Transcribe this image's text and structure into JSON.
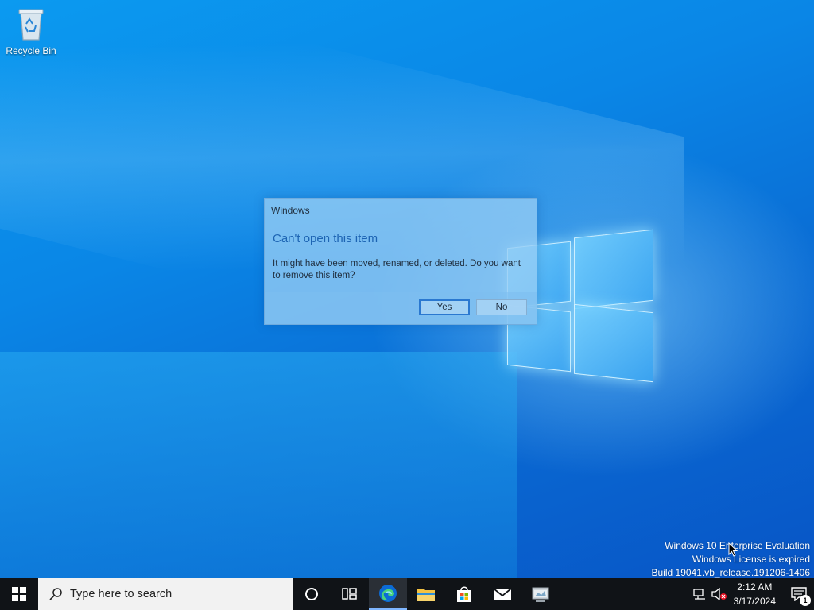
{
  "desktop": {
    "icons": [
      {
        "label": "Recycle Bin",
        "icon": "recycle-bin-icon"
      }
    ]
  },
  "dialog": {
    "title": "Windows",
    "heading": "Can't open this item",
    "message": "It might have been moved, renamed, or deleted. Do you want to remove this item?",
    "yes_label": "Yes",
    "no_label": "No"
  },
  "watermark": {
    "line1": "Windows 10 Enterprise Evaluation",
    "line2": "Windows License is expired",
    "line3": "Build 19041.vb_release.191206-1406"
  },
  "taskbar": {
    "search_placeholder": "Type here to search",
    "pinned": [
      {
        "name": "cortana",
        "icon": "cortana-circle-icon"
      },
      {
        "name": "task-view",
        "icon": "task-view-icon"
      },
      {
        "name": "edge",
        "icon": "edge-icon",
        "active": true
      },
      {
        "name": "file-explorer",
        "icon": "folder-icon"
      },
      {
        "name": "microsoft-store",
        "icon": "store-icon"
      },
      {
        "name": "mail",
        "icon": "mail-icon"
      },
      {
        "name": "app",
        "icon": "app-window-icon"
      }
    ],
    "clock": {
      "time": "2:12 AM",
      "date": "3/17/2024"
    },
    "notifications_count": "1"
  },
  "colors": {
    "accent": "#1d64b3",
    "taskbar": "#101317",
    "desktop": "#0a6fd6"
  }
}
